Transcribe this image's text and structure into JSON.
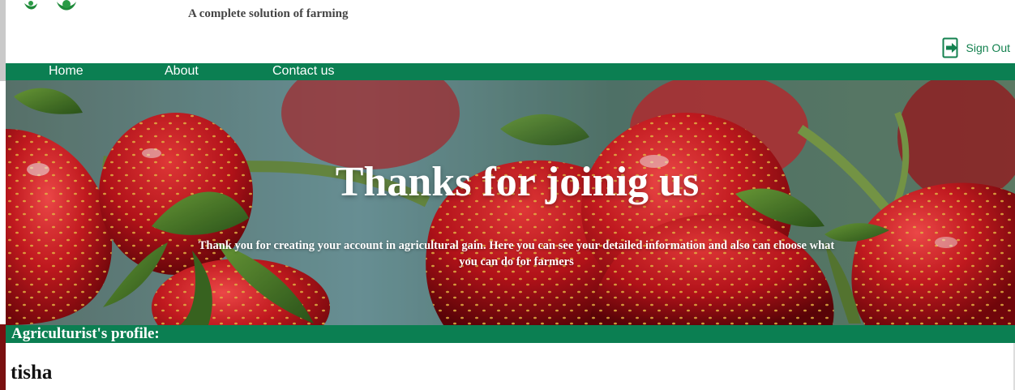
{
  "header": {
    "tagline": "A complete solution of farming",
    "signout_label": "Sign Out"
  },
  "nav": {
    "items": [
      {
        "label": "Home"
      },
      {
        "label": "About"
      },
      {
        "label": "Contact us"
      }
    ]
  },
  "hero": {
    "title": "Thanks for joinig us",
    "subtitle": "Thank you for creating your account in agricultural gain. Here you can see your detailed information and also can choose what you can do for farmers"
  },
  "profile": {
    "section_label": "Agriculturist's profile:",
    "username": "tisha"
  },
  "colors": {
    "brand_green": "#0b7f52",
    "signout_green": "#13814f"
  }
}
